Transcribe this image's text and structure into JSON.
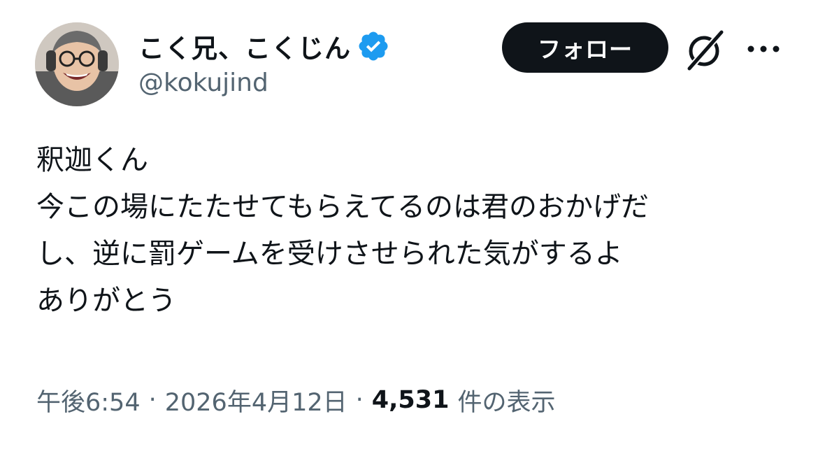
{
  "author": {
    "display_name": "こく兄、こくじん",
    "handle": "@kokujind",
    "verified": true
  },
  "actions": {
    "follow_label": "フォロー",
    "grok_icon": "grok-slash-icon",
    "more_icon": "more-horizontal-icon"
  },
  "tweet": {
    "lines": [
      "釈迦くん",
      "今この場にたたせてもらえてるのは君のおかげだ",
      "し、逆に罰ゲームを受けさせられた気がするよ",
      "ありがとう"
    ]
  },
  "meta": {
    "time": "午後6:54",
    "separator": "·",
    "date": "2026年4月12日",
    "views_count": "4,531",
    "views_label": "件の表示"
  },
  "colors": {
    "text_primary": "#0f1419",
    "text_secondary": "#536471",
    "verified_blue": "#1d9bf0",
    "follow_bg": "#0f1419"
  }
}
